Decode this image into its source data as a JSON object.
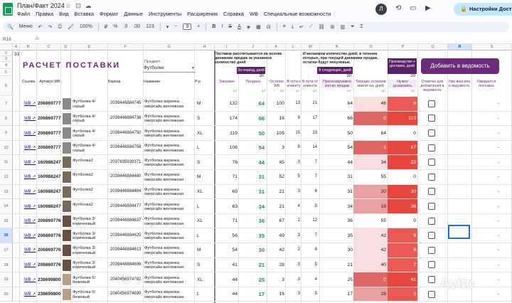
{
  "app": {
    "doc_title": "План/Факт 2024",
    "menu": [
      "Файл",
      "Правка",
      "Вид",
      "Вставка",
      "Формат",
      "Данные",
      "Инструменты",
      "Расширения",
      "Справка",
      "WB",
      "Специальные возможности"
    ],
    "avatar_letter": "Л",
    "share_label": "Настройки Досту"
  },
  "toolbar": {
    "search_label": "Меню",
    "zoom": "100%",
    "currency": "₽",
    "percent": "%",
    "decimals_less": ".0",
    "decimals_more": ".00",
    "number_format": "123",
    "font_size": "9",
    "bold": "B",
    "italic": "I",
    "strike": "S",
    "text_color": "A"
  },
  "formula_bar": {
    "cell_ref": "R16",
    "fx": "fx"
  },
  "columns": [
    "A",
    "B",
    "C",
    "D",
    "E",
    "F",
    "G",
    "H",
    "I",
    "J",
    "K",
    "L",
    "M",
    "N",
    "O",
    "P",
    "Q",
    "R",
    "S"
  ],
  "rows_top": [
    "2",
    "3",
    "4",
    "5",
    "6"
  ],
  "sheet": {
    "a2_value": "33",
    "title": "РАСЧЕТ ПОСТАВКИ",
    "predmet_label": "Предмет",
    "predmet_value": "Футболки",
    "note_supply": "Поставка рассчитывается на основе динамики продаж за указанное количество дней",
    "note_wish": "И желаемом количестве дней, в течении которых, при текущей динамики продаж, остатки будут ненулевые.",
    "period_label": "За период, дней",
    "period_value": "30",
    "next_label": "В следующие, дней",
    "next_value": "30",
    "prod_label": "Производство + доставка, дней",
    "prod_value": "20",
    "add_button": "Добавить в ведомость"
  },
  "headers": {
    "link": "Ссылка",
    "article": "Артикул WB",
    "barcode": "Баркод",
    "name": "Название",
    "size": "Р-р",
    "ordered": "Заказано",
    "sold": "Продано",
    "stock": "Остаток WB",
    "in_transit": "В пути к клиенту",
    "in_transit2": "В пути от клиента",
    "forecast": "Прогнозируемое кол-во продаж",
    "current_stock": "Текущих остатков хватит на, дней",
    "need": "Нужно дозаказать",
    "mark": "Отметка для добавления в ведомость",
    "already": "Уже внесено в ведомость",
    "expected": "Ожидается поставка",
    "sub_ordered": "шт",
    "sub_sold": "шт",
    "sub_stock": "шт",
    "sub_path1": "шт",
    "sub_path2": "шт",
    "sub_forecast": "шт",
    "sub_days": "дн",
    "sub_need": "шт"
  },
  "rows": [
    {
      "n": "7",
      "link": "WB ↗",
      "article": "206869777",
      "barcode": "2039446884745",
      "name": "Футболка варенка оверсайз винтажная.",
      "color": "Футболка 4/серый",
      "size": "M",
      "ordered": "132",
      "sold": "64",
      "stock": "100",
      "p1": "13",
      "p2": "21",
      "forecast": "64",
      "days": "46",
      "need": "6",
      "dash": "-",
      "tone": "#8a8a8a"
    },
    {
      "n": "8",
      "link": "WB ↗",
      "article": "206869777",
      "barcode": "2039446884736",
      "name": "Футболка варенка оверсайз винтажная.",
      "color": "Футболка 4/серый",
      "size": "S",
      "ordered": "174",
      "sold": "66",
      "stock": "16",
      "p1": "9",
      "p2": "17",
      "forecast": "66",
      "days": "0",
      "need": "110",
      "dash": "-",
      "tone": "#8a8a8a"
    },
    {
      "n": "9",
      "link": "WB ↗",
      "article": "206869777",
      "barcode": "2039446884750",
      "name": "Футболка варенка оверсайз винтажная.",
      "color": "Футболка 4/серый",
      "size": "XL",
      "ordered": "119",
      "sold": "50",
      "stock": "105",
      "p1": "15",
      "p2": "23",
      "forecast": "50",
      "days": "64",
      "need": "0",
      "dash": "-",
      "tone": "#8a8a8a"
    },
    {
      "n": "10",
      "link": "WB ↗",
      "article": "206869777",
      "barcode": "2039446884758",
      "name": "Футболка варенка оверсайз винтажная.",
      "color": "Футболка 4/серый",
      "size": "L",
      "ordered": "106",
      "sold": "54",
      "stock": "3",
      "p1": "8",
      "p2": "14",
      "forecast": "54",
      "days": "1",
      "need": "87",
      "dash": "-",
      "tone": "#8a8a8a"
    },
    {
      "n": "11",
      "link": "WB ↗",
      "article": "160988247",
      "barcode": "2037835939371",
      "name": "Футболка варенка оверсайз винтажная.",
      "color": "Футболка2",
      "size": "S",
      "ordered": "76",
      "sold": "44",
      "stock": "45",
      "p1": "3",
      "p2": "7",
      "forecast": "44",
      "days": "34",
      "need": "22",
      "dash": "-",
      "tone": "#7a6a5a"
    },
    {
      "n": "12",
      "link": "WB ↗",
      "article": "160988247",
      "barcode": "2039446884460",
      "name": "Футболка варенка оверсайз винтажная.",
      "color": "Футболка2",
      "size": "M",
      "ordered": "71",
      "sold": "31",
      "stock": "52",
      "p1": "5",
      "p2": "7",
      "forecast": "31",
      "days": "55",
      "need": "0",
      "dash": "-",
      "tone": "#7a6a5a"
    },
    {
      "n": "13",
      "link": "WB ↗",
      "article": "160988247",
      "barcode": "2039446884484",
      "name": "Футболка варенка оверсайз винтажная.",
      "color": "Футболка2",
      "size": "XL",
      "ordered": "69",
      "sold": "31",
      "stock": "21",
      "p1": "3",
      "p2": "6",
      "forecast": "31",
      "days": "20",
      "need": "30",
      "dash": "-",
      "tone": "#7a6a5a"
    },
    {
      "n": "14",
      "link": "WB ↗",
      "article": "160988247",
      "barcode": "2039446884477",
      "name": "Футболка варенка оверсайз винтажная.",
      "color": "Футболка2",
      "size": "L",
      "ordered": "63",
      "sold": "34",
      "stock": "21",
      "p1": "4",
      "p2": "5",
      "forecast": "34",
      "days": "18",
      "need": "36",
      "dash": "-",
      "tone": "#7a6a5a"
    },
    {
      "n": "15",
      "link": "WB ↗",
      "article": "206869776",
      "barcode": "2039446884637",
      "name": "Футболка варенка оверсайз винтажная.",
      "color": "Футболка 3/коричневый",
      "size": "XL",
      "ordered": "71",
      "sold": "36",
      "stock": "67",
      "p1": "2",
      "p2": "12",
      "forecast": "36",
      "days": "55",
      "need": "0",
      "dash": "-",
      "tone": "#6a4e3e"
    },
    {
      "n": "16",
      "link": "WB ↗",
      "article": "206869776",
      "barcode": "2039446884620",
      "name": "Футболка варенка оверсайз винтажная.",
      "color": "Футболка 3/коричневый",
      "size": "L",
      "ordered": "56",
      "sold": "35",
      "stock": "49",
      "p1": "3",
      "p2": "7",
      "forecast": "35",
      "days": "42",
      "need": "9",
      "dash": "-",
      "tone": "#6a4e3e"
    },
    {
      "n": "17",
      "link": "WB ↗",
      "article": "206869776",
      "barcode": "2039446884613",
      "name": "Футболка варенка оверсайз винтажная.",
      "color": "Футболка 3/коричневый",
      "size": "M",
      "ordered": "54",
      "sold": "30",
      "stock": "42",
      "p1": "2",
      "p2": "6",
      "forecast": "30",
      "days": "42",
      "need": "8",
      "dash": "-",
      "tone": "#6a4e3e"
    },
    {
      "n": "18",
      "link": "WB ↗",
      "article": "206869776",
      "barcode": "2039446884606",
      "name": "Футболка варенка оверсайз винтажная.",
      "color": "Футболка 3/коричневый",
      "size": "S",
      "ordered": "41",
      "sold": "21",
      "stock": "28",
      "p1": "3",
      "p2": "5",
      "forecast": "21",
      "days": "40",
      "need": "7",
      "dash": "-",
      "tone": "#6a4e3e"
    },
    {
      "n": "19",
      "link": "WB ↗",
      "article": "238699800",
      "barcode": "2040456974782",
      "name": "Футболка варенка оверсайз винтажная.",
      "color": "Футболка 6/ бежевый",
      "size": "XL",
      "ordered": "44",
      "sold": "25",
      "stock": "3",
      "p1": "3",
      "p2": "4",
      "forecast": "25",
      "days": "0",
      "need": "41",
      "dash": "-",
      "tone": "#b89e84"
    },
    {
      "n": "20",
      "link": "WB ↗",
      "article": "238699800",
      "barcode": "2040456974690",
      "name": "Футболка варенка оверсайз винтажная.",
      "color": "Футболка 6/ бежевый",
      "size": "L",
      "ordered": "44",
      "sold": "17",
      "stock": "16",
      "p1": "3",
      "p2": "5",
      "forecast": "17",
      "days": "28",
      "need": "5",
      "dash": "-",
      "tone": "#b89e84"
    }
  ],
  "colors": {
    "purple": "#6b2b7a",
    "dark_purple": "#5b2168",
    "green": "#1e8e3e",
    "red_strong": "#e8453c",
    "red_mid": "#e06666",
    "red_light": "#f4cccc",
    "selection": "#1a73e8"
  },
  "watermark": "Avito"
}
